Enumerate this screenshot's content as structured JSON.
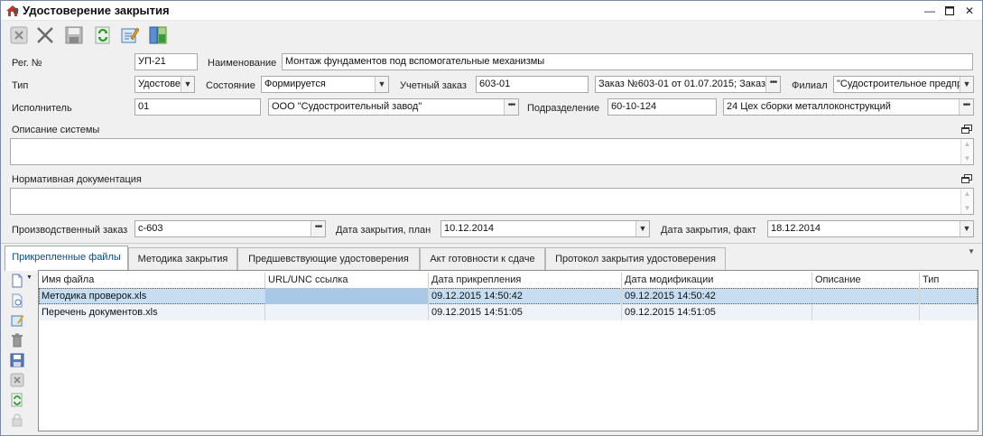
{
  "window": {
    "title": "Удостоверение закрытия"
  },
  "toolbar": {
    "buttons": [
      "cancel-icon",
      "close-x-icon",
      "save-icon",
      "refresh-icon",
      "edit-icon",
      "layout-icon"
    ]
  },
  "form": {
    "reg_no": {
      "label": "Рег. №",
      "value": "УП-21"
    },
    "name": {
      "label": "Наименование",
      "value": "Монтаж фундаментов под вспомогательные механизмы"
    },
    "type": {
      "label": "Тип",
      "value": "Удостовер"
    },
    "state": {
      "label": "Состояние",
      "value": "Формируется"
    },
    "account_order": {
      "label": "Учетный заказ",
      "value": "603-01",
      "ref": "Заказ №603-01 от 01.07.2015; Заказ"
    },
    "branch": {
      "label": "Филиал",
      "value": "\"Судостроительное предпр"
    },
    "executor": {
      "label": "Исполнитель",
      "value": "01",
      "ref": "ООО \"Судостроительный завод\""
    },
    "department": {
      "label": "Подразделение",
      "value": "60-10-124",
      "ref": "24 Цех сборки металлоконструкций"
    },
    "system_description": {
      "label": "Описание системы",
      "value": ""
    },
    "normative_docs": {
      "label": "Нормативная документация",
      "value": ""
    },
    "production_order": {
      "label": "Производственный заказ",
      "value": "с-603"
    },
    "close_date_plan": {
      "label": "Дата закрытия, план",
      "value": "10.12.2014"
    },
    "close_date_fact": {
      "label": "Дата закрытия, факт",
      "value": "18.12.2014"
    }
  },
  "tabs": [
    {
      "label": "Прикрепленные файлы",
      "active": true
    },
    {
      "label": "Методика закрытия",
      "active": false
    },
    {
      "label": "Предшевствующие  удостоверения",
      "active": false
    },
    {
      "label": "Акт готовности к сдаче",
      "active": false
    },
    {
      "label": "Протокол закрытия удостоверения",
      "active": false
    }
  ],
  "grid": {
    "columns": [
      "Имя файла",
      "URL/UNC ссылка",
      "Дата прикрепления",
      "Дата модификации",
      "Описание",
      "Тип"
    ],
    "rows": [
      [
        "Методика проверок.xls",
        "",
        "09.12.2015 14:50:42",
        "09.12.2015 14:50:42",
        "",
        ""
      ],
      [
        "Перечень документов.xls",
        "",
        "09.12.2015 14:51:05",
        "09.12.2015 14:51:05",
        "",
        ""
      ]
    ]
  },
  "colors": {
    "selected_row": "#c6ddf2",
    "active_tab_text": "#0a4a8a"
  }
}
